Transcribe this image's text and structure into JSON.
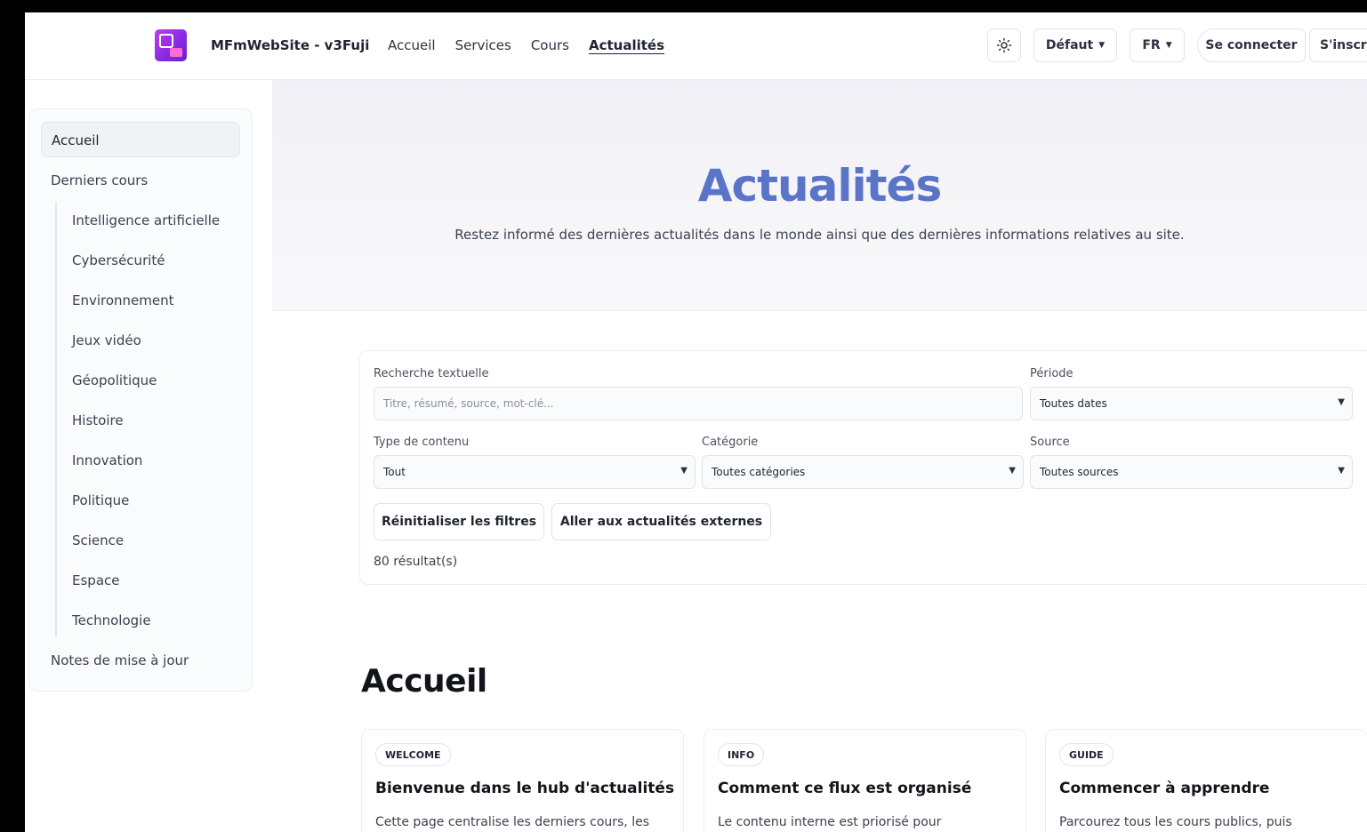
{
  "header": {
    "site_name": "MFmWebSite - v3Fuji",
    "nav": [
      "Accueil",
      "Services",
      "Cours",
      "Actualités"
    ],
    "active_nav": "Actualités",
    "theme_label": "Défaut",
    "lang_label": "FR",
    "login_label": "Se connecter",
    "signup_label": "S'inscri"
  },
  "sidebar": {
    "home": "Accueil",
    "recent_courses": "Derniers cours",
    "categories": [
      "Intelligence artificielle",
      "Cybersécurité",
      "Environnement",
      "Jeux vidéo",
      "Géopolitique",
      "Histoire",
      "Innovation",
      "Politique",
      "Science",
      "Espace",
      "Technologie"
    ],
    "release_notes": "Notes de mise à jour"
  },
  "hero": {
    "title": "Actualités",
    "subtitle": "Restez informé des dernières actualités dans le monde ainsi que des dernières informations relatives au site."
  },
  "filters": {
    "search_label": "Recherche textuelle",
    "search_placeholder": "Titre, résumé, source, mot-clé...",
    "period_label": "Période",
    "period_value": "Toutes dates",
    "type_label": "Type de contenu",
    "type_value": "Tout",
    "category_label": "Catégorie",
    "category_value": "Toutes catégories",
    "source_label": "Source",
    "source_value": "Toutes sources",
    "reset_label": "Réinitialiser les filtres",
    "external_label": "Aller aux actualités externes",
    "results": "80 résultat(s)"
  },
  "section": {
    "title": "Accueil",
    "cards": [
      {
        "badge": "WELCOME",
        "title": "Bienvenue dans le hub d'actualités",
        "text": "Cette page centralise les derniers cours, les"
      },
      {
        "badge": "INFO",
        "title": "Comment ce flux est organisé",
        "text": "Le contenu interne est priorisé pour"
      },
      {
        "badge": "GUIDE",
        "title": "Commencer à apprendre",
        "text": "Parcourez tous les cours publics, puis"
      }
    ]
  },
  "icons": {
    "theme": "sun-icon",
    "chevron": "chevron-down-icon"
  },
  "colors": {
    "accent": "#5a74c8",
    "logo": "#8a2be2"
  }
}
